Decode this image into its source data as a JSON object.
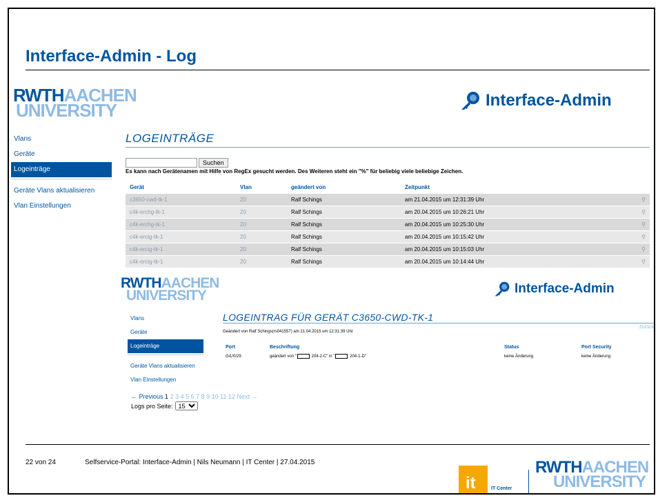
{
  "slide": {
    "title": "Interface-Admin - Log",
    "footer": {
      "page": "22 von 24",
      "caption": "Selfservice-Portal: Interface-Admin  |  Nils Neumann |  IT Center  |  27.04.2015",
      "itcenter_label": "IT Center",
      "itcenter_mark": "it"
    }
  },
  "logo": {
    "part1": "RWTH",
    "part2": "AACHEN",
    "part3": "UNIVERSITY"
  },
  "app_title": "Interface-Admin",
  "nav": {
    "vlans": "Vlans",
    "geraete": "Geräte",
    "logeintraege": "Logeinträge",
    "aktualisieren": "Geräte Vlans aktualisieren",
    "einstellungen": "Vlan Einstellungen"
  },
  "log_page": {
    "heading": "LOGEINTRÄGE",
    "search_button": "Suchen",
    "search_value": "",
    "regex_note": "Es kann nach Gerätenamen mit Hilfe von RegEx gesucht werden. Des Weiteren steht ein \"%\" für beliebig viele beliebige Zeichen.",
    "columns": [
      "Gerät",
      "Vlan",
      "geändert von",
      "Zeitpunkt"
    ],
    "rows": [
      [
        "c3650-cwd-tk-1",
        "20",
        "Ralf Schings",
        "am 21.04.2015 um 12:31:39 Uhr"
      ],
      [
        "c4k-erchg-tk-1",
        "20",
        "Ralf Schings",
        "am 20.04.2015 um 10:26:21 Uhr"
      ],
      [
        "c4k-erchg-tk-1",
        "20",
        "Ralf Schings",
        "am 20.04.2015 um 10:25:30 Uhr"
      ],
      [
        "c4k-ercig-tk-1",
        "20",
        "Ralf Schings",
        "am 20.04.2015 um 10:15:42 Uhr"
      ],
      [
        "c4k-ercig-tk-1",
        "20",
        "Ralf Schings",
        "am 20.04.2015 um 10:15:03 Uhr"
      ],
      [
        "c4k-ercig-tk-1",
        "20",
        "Ralf Schings",
        "am 20.04.2015 um 10:14:44 Uhr"
      ]
    ]
  },
  "detail_page": {
    "heading": "LOGEINTRAG FÜR GERÄT C3650-CWD-TK-1",
    "back": "Zurück",
    "changed_by": "Geändert von Ralf Schings(rs041557) am 21.04.2015 um 12:31:39 Uhr",
    "columns": [
      "Port",
      "Beschriftung",
      "Status",
      "Port Security"
    ],
    "row": {
      "port": "Gi1/0/29",
      "desc_a": "geändert von \"",
      "desc_b": " 204-2-C\" in \"",
      "desc_c": " 204-1-D\"",
      "status": "keine Änderung",
      "security": "keine Änderung"
    }
  },
  "pagination": {
    "previous": "← Previous",
    "current": "1",
    "pages": "2 3 4 5 6 7 8 9 10 11 12",
    "next": "Next →",
    "per_page_label": "Logs pro Seite:",
    "per_page_value": "15"
  }
}
